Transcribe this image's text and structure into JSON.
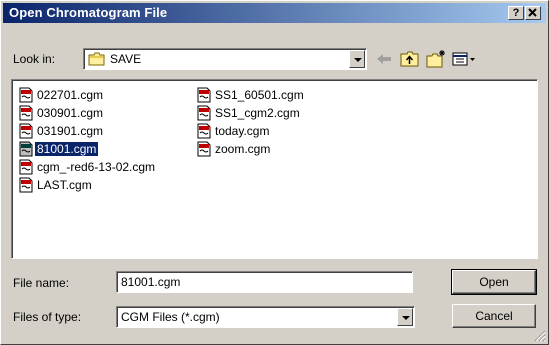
{
  "window": {
    "title": "Open Chromatogram File",
    "help_button": "?",
    "close_button": "X"
  },
  "look_in": {
    "label": "Look in:",
    "value": "SAVE",
    "icon": "folder-icon"
  },
  "toolbar": {
    "back_icon": "back-arrow-icon",
    "up_icon": "up-folder-icon",
    "new_folder_icon": "new-folder-icon",
    "view_menu_icon": "view-menu-icon"
  },
  "files": [
    {
      "name": "022701.cgm",
      "selected": false
    },
    {
      "name": "030901.cgm",
      "selected": false
    },
    {
      "name": "031901.cgm",
      "selected": false
    },
    {
      "name": "81001.cgm",
      "selected": true
    },
    {
      "name": "cgm_-red6-13-02.cgm",
      "selected": false
    },
    {
      "name": "LAST.cgm",
      "selected": false
    },
    {
      "name": "SS1_60501.cgm",
      "selected": false
    },
    {
      "name": "SS1_cgm2.cgm",
      "selected": false
    },
    {
      "name": "today.cgm",
      "selected": false
    },
    {
      "name": "zoom.cgm",
      "selected": false
    }
  ],
  "file_icon": "document-icon",
  "file_name": {
    "label": "File name:",
    "value": "81001.cgm"
  },
  "file_type": {
    "label": "Files of type:",
    "value": "CGM Files (*.cgm)"
  },
  "buttons": {
    "open": "Open",
    "cancel": "Cancel"
  },
  "colors": {
    "title_start": "#0a246a",
    "title_end": "#a6caf0",
    "selection": "#0a246a",
    "face": "#d4d0c8"
  }
}
